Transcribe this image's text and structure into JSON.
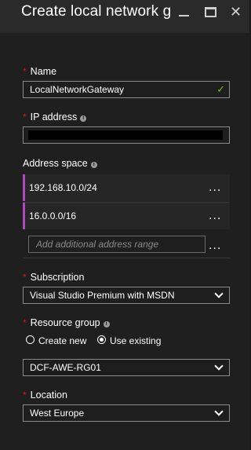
{
  "title": "Create local network g...",
  "window": {
    "close_glyph": "✕"
  },
  "name": {
    "label": "Name",
    "value": "LocalNetworkGateway",
    "check_glyph": "✓"
  },
  "ip": {
    "label": "IP address"
  },
  "address_space": {
    "label": "Address space",
    "items": [
      "192.168.10.0/24",
      "16.0.0.0/16"
    ],
    "placeholder": "Add additional address range",
    "more_glyph": "..."
  },
  "subscription": {
    "label": "Subscription",
    "value": "Visual Studio Premium with MSDN"
  },
  "resource_group": {
    "label": "Resource group",
    "options": [
      "Create new",
      "Use existing"
    ],
    "selected": "Use existing",
    "value": "DCF-AWE-RG01"
  },
  "location": {
    "label": "Location",
    "value": "West Europe"
  },
  "required_mark": "*",
  "info_glyph": "i",
  "colors": {
    "accent_bar": "#b146c2",
    "required": "#e81123",
    "valid": "#7fba00"
  }
}
